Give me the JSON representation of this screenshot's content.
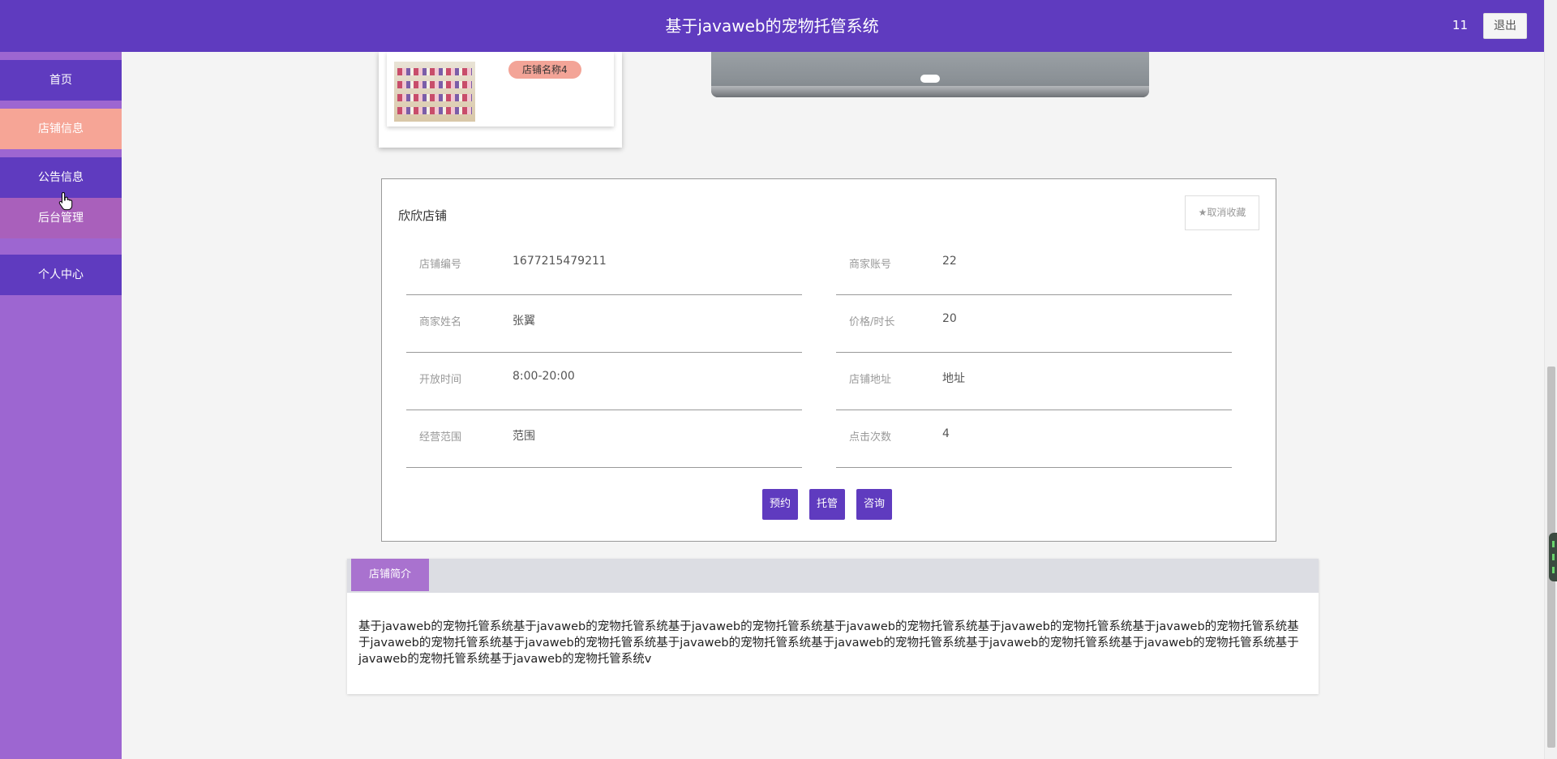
{
  "header": {
    "title": "基于javaweb的宠物托管系统",
    "username": "11",
    "logout_label": "退出"
  },
  "sidebar": {
    "items": [
      {
        "label": "首页"
      },
      {
        "label": "店铺信息"
      },
      {
        "label": "公告信息"
      },
      {
        "label": "后台管理"
      },
      {
        "label": "个人中心"
      }
    ]
  },
  "shop_card": {
    "name_badge": "店铺名称4"
  },
  "detail": {
    "shop_name": "欣欣店铺",
    "favorite_label": "★取消收藏",
    "fields": {
      "shop_no": {
        "label": "店铺编号",
        "value": "1677215479211"
      },
      "merchant_account": {
        "label": "商家账号",
        "value": "22"
      },
      "merchant_name": {
        "label": "商家姓名",
        "value": "张翼"
      },
      "price_duration": {
        "label": "价格/时长",
        "value": "20"
      },
      "open_time": {
        "label": "开放时间",
        "value": "8:00-20:00"
      },
      "address": {
        "label": "店铺地址",
        "value": "地址"
      },
      "scope": {
        "label": "经营范围",
        "value": "范围"
      },
      "clicks": {
        "label": "点击次数",
        "value": "4"
      }
    },
    "actions": {
      "reserve": "预约",
      "host": "托管",
      "consult": "咨询"
    }
  },
  "intro": {
    "tab_label": "店铺简介",
    "text": "基于javaweb的宠物托管系统基于javaweb的宠物托管系统基于javaweb的宠物托管系统基于javaweb的宠物托管系统基于javaweb的宠物托管系统基于javaweb的宠物托管系统基于javaweb的宠物托管系统基于javaweb的宠物托管系统基于javaweb的宠物托管系统基于javaweb的宠物托管系统基于javaweb的宠物托管系统基于javaweb的宠物托管系统基于javaweb的宠物托管系统基于javaweb的宠物托管系统v"
  },
  "colors": {
    "primary": "#5f3bbf",
    "sidebar_bg": "#9d66d1",
    "active_nav": "#f6a596",
    "tab_active": "#a972cf"
  }
}
